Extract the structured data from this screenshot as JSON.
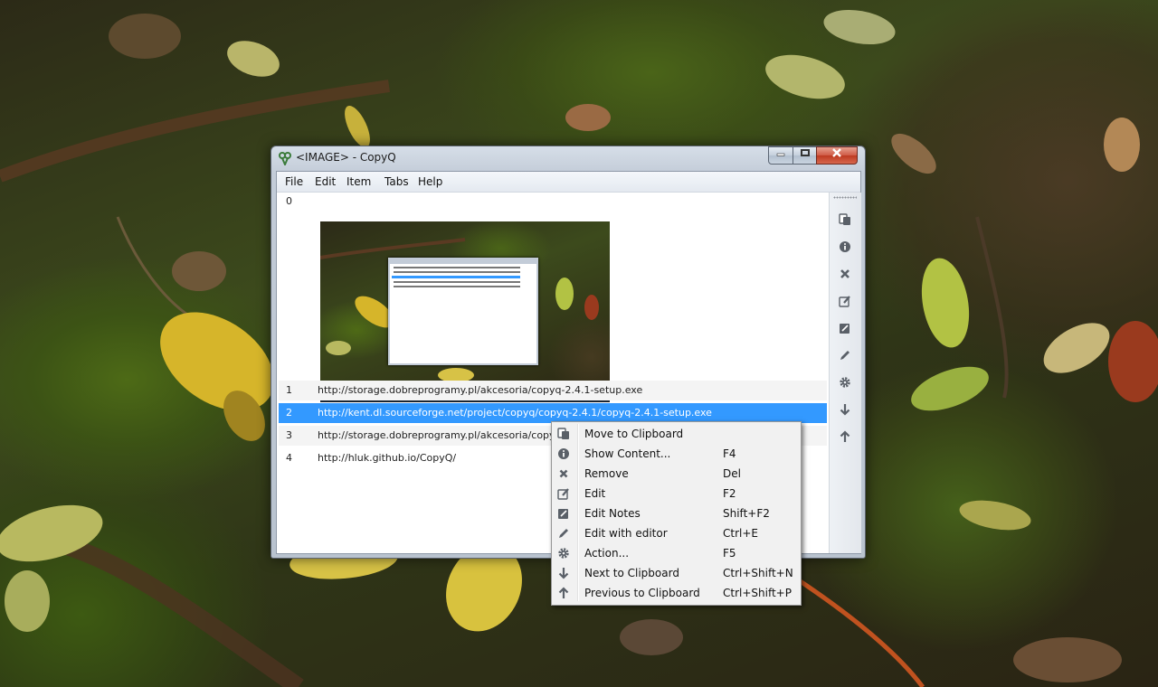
{
  "window": {
    "title": "<IMAGE> - CopyQ"
  },
  "menubar": {
    "items": [
      "File",
      "Edit",
      "Item",
      "Tabs",
      "Help"
    ]
  },
  "items": [
    {
      "index": "0",
      "content": ""
    },
    {
      "index": "1",
      "content": "http://storage.dobreprogramy.pl/akcesoria/copyq-2.4.1-setup.exe"
    },
    {
      "index": "2",
      "content": "http://kent.dl.sourceforge.net/project/copyq/copyq-2.4.1/copyq-2.4.1-setup.exe",
      "selected": true
    },
    {
      "index": "3",
      "content": "http://storage.dobreprogramy.pl/akcesoria/copyq-2.4.1-setup.exe"
    },
    {
      "index": "4",
      "content": "http://hluk.github.io/CopyQ/"
    }
  ],
  "toolbar": {
    "icons": [
      "copy-to-clipboard-icon",
      "info-icon",
      "close-icon",
      "edit-icon",
      "edit-notes-icon",
      "pencil-icon",
      "gear-icon",
      "arrow-down-icon",
      "arrow-up-icon"
    ]
  },
  "context_menu": {
    "items": [
      {
        "label": "Move to Clipboard",
        "shortcut": "",
        "icon": "copy-to-clipboard-icon"
      },
      {
        "label": "Show Content...",
        "shortcut": "F4",
        "icon": "info-icon"
      },
      {
        "label": "Remove",
        "shortcut": "Del",
        "icon": "close-icon"
      },
      {
        "label": "Edit",
        "shortcut": "F2",
        "icon": "edit-icon"
      },
      {
        "label": "Edit Notes",
        "shortcut": "Shift+F2",
        "icon": "edit-notes-icon"
      },
      {
        "label": "Edit with editor",
        "shortcut": "Ctrl+E",
        "icon": "pencil-icon"
      },
      {
        "label": "Action...",
        "shortcut": "F5",
        "icon": "gear-icon"
      },
      {
        "label": "Next to Clipboard",
        "shortcut": "Ctrl+Shift+N",
        "icon": "arrow-down-icon"
      },
      {
        "label": "Previous to Clipboard",
        "shortcut": "Ctrl+Shift+P",
        "icon": "arrow-up-icon"
      }
    ]
  },
  "colors": {
    "selection": "#3399ff",
    "icon": "#5a6068"
  }
}
